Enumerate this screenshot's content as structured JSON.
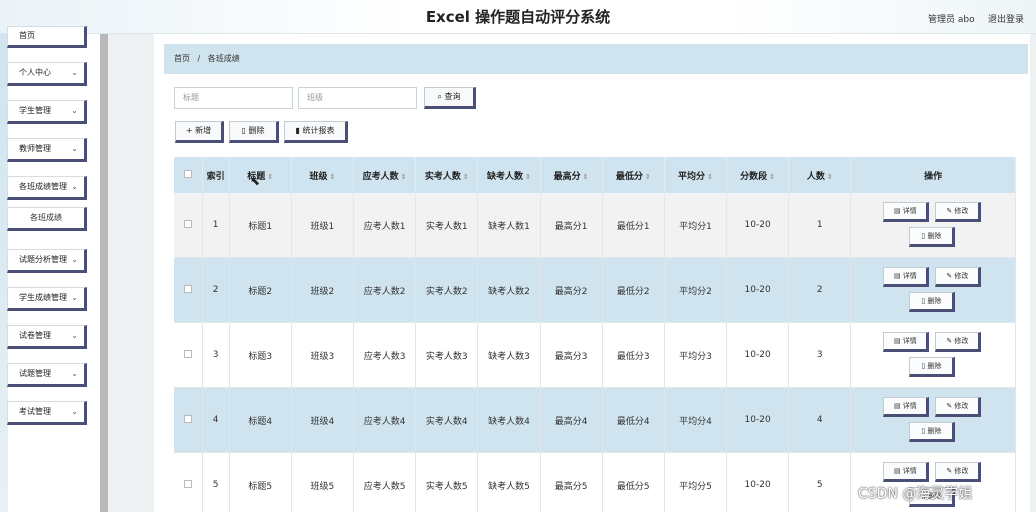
{
  "header": {
    "title": "Excel 操作题自动评分系统",
    "user": "管理员 abo",
    "logout": "退出登录"
  },
  "sidebar": {
    "items": [
      {
        "label": "首页",
        "chev": ""
      },
      {
        "label": "个人中心",
        "chev": "⌄"
      },
      {
        "label": "学生管理",
        "chev": "⌄"
      },
      {
        "label": "教师管理",
        "chev": "⌄"
      },
      {
        "label": "各班成绩管理",
        "chev": "⌄"
      },
      {
        "label": "各班成绩",
        "chev": ""
      },
      {
        "label": "试题分析管理",
        "chev": "⌄"
      },
      {
        "label": "学生成绩管理",
        "chev": "⌄"
      },
      {
        "label": "试卷管理",
        "chev": "⌄"
      },
      {
        "label": "试题管理",
        "chev": "⌄"
      },
      {
        "label": "考试管理",
        "chev": "⌄"
      }
    ]
  },
  "breadcrumb": {
    "home": "首页",
    "sep": "/",
    "current": "各班成绩"
  },
  "search": {
    "title_placeholder": "标题",
    "class_placeholder": "班级",
    "search_label": "查询",
    "search_icon": "search-icon"
  },
  "toolbar": {
    "add_label": "+ 新增",
    "delete_label": "删除",
    "stats_label": "统计报表"
  },
  "table": {
    "headers": {
      "index": "索引",
      "title": "标题",
      "class": "班级",
      "expected": "应考人数",
      "actual": "实考人数",
      "absent": "缺考人数",
      "max": "最高分",
      "min": "最低分",
      "avg": "平均分",
      "range": "分数段",
      "count": "人数",
      "ops": "操作"
    },
    "rows": [
      {
        "index": "1",
        "title": "标题1",
        "class": "班级1",
        "expected": "应考人数1",
        "actual": "实考人数1",
        "absent": "缺考人数1",
        "max": "最高分1",
        "min": "最低分1",
        "avg": "平均分1",
        "range": "10-20",
        "count": "1"
      },
      {
        "index": "2",
        "title": "标题2",
        "class": "班级2",
        "expected": "应考人数2",
        "actual": "实考人数2",
        "absent": "缺考人数2",
        "max": "最高分2",
        "min": "最低分2",
        "avg": "平均分2",
        "range": "10-20",
        "count": "2"
      },
      {
        "index": "3",
        "title": "标题3",
        "class": "班级3",
        "expected": "应考人数3",
        "actual": "实考人数3",
        "absent": "缺考人数3",
        "max": "最高分3",
        "min": "最低分3",
        "avg": "平均分3",
        "range": "10-20",
        "count": "3"
      },
      {
        "index": "4",
        "title": "标题4",
        "class": "班级4",
        "expected": "应考人数4",
        "actual": "实考人数4",
        "absent": "缺考人数4",
        "max": "最高分4",
        "min": "最低分4",
        "avg": "平均分4",
        "range": "10-20",
        "count": "4"
      },
      {
        "index": "5",
        "title": "标题5",
        "class": "班级5",
        "expected": "应考人数5",
        "actual": "实考人数5",
        "absent": "缺考人数5",
        "max": "最高分5",
        "min": "最低分5",
        "avg": "平均分5",
        "range": "10-20",
        "count": "5"
      }
    ],
    "op_labels": {
      "detail": "详情",
      "edit": "修改",
      "delete": "删除"
    }
  },
  "watermark": "CSDN @海灵学姐",
  "colors": {
    "accent_light": "#cfe4ef",
    "button_border": "#4a4f75"
  }
}
